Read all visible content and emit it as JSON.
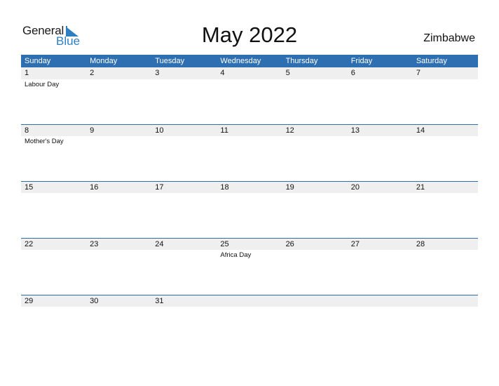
{
  "logo": {
    "general": "General",
    "blue": "Blue",
    "accent_color": "#2d7fc1"
  },
  "title": "May 2022",
  "country": "Zimbabwe",
  "colors": {
    "header_bg": "#2d6fb0",
    "row_strip": "#efefef"
  },
  "weekdays": [
    "Sunday",
    "Monday",
    "Tuesday",
    "Wednesday",
    "Thursday",
    "Friday",
    "Saturday"
  ],
  "weeks": [
    {
      "days": [
        {
          "num": "1",
          "event": "Labour Day"
        },
        {
          "num": "2",
          "event": ""
        },
        {
          "num": "3",
          "event": ""
        },
        {
          "num": "4",
          "event": ""
        },
        {
          "num": "5",
          "event": ""
        },
        {
          "num": "6",
          "event": ""
        },
        {
          "num": "7",
          "event": ""
        }
      ]
    },
    {
      "days": [
        {
          "num": "8",
          "event": "Mother's Day"
        },
        {
          "num": "9",
          "event": ""
        },
        {
          "num": "10",
          "event": ""
        },
        {
          "num": "11",
          "event": ""
        },
        {
          "num": "12",
          "event": ""
        },
        {
          "num": "13",
          "event": ""
        },
        {
          "num": "14",
          "event": ""
        }
      ]
    },
    {
      "days": [
        {
          "num": "15",
          "event": ""
        },
        {
          "num": "16",
          "event": ""
        },
        {
          "num": "17",
          "event": ""
        },
        {
          "num": "18",
          "event": ""
        },
        {
          "num": "19",
          "event": ""
        },
        {
          "num": "20",
          "event": ""
        },
        {
          "num": "21",
          "event": ""
        }
      ]
    },
    {
      "days": [
        {
          "num": "22",
          "event": ""
        },
        {
          "num": "23",
          "event": ""
        },
        {
          "num": "24",
          "event": ""
        },
        {
          "num": "25",
          "event": "Africa Day"
        },
        {
          "num": "26",
          "event": ""
        },
        {
          "num": "27",
          "event": ""
        },
        {
          "num": "28",
          "event": ""
        }
      ]
    },
    {
      "days": [
        {
          "num": "29",
          "event": ""
        },
        {
          "num": "30",
          "event": ""
        },
        {
          "num": "31",
          "event": ""
        },
        {
          "num": "",
          "event": ""
        },
        {
          "num": "",
          "event": ""
        },
        {
          "num": "",
          "event": ""
        },
        {
          "num": "",
          "event": ""
        }
      ]
    }
  ]
}
